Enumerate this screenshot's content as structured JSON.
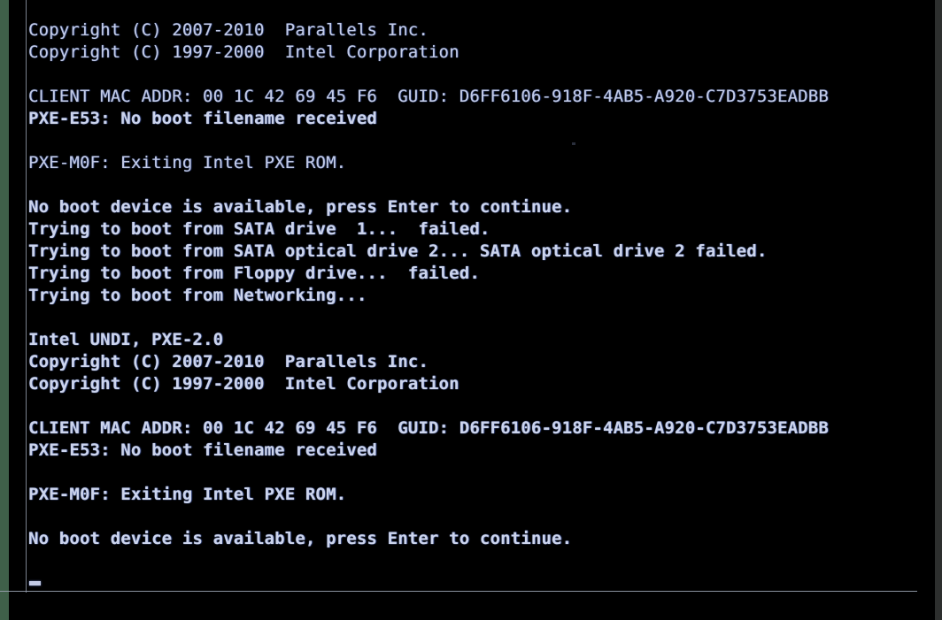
{
  "screen": {
    "title": "Parallels PXE boot console",
    "background_color": "#000000",
    "text_color": "#c3cbe6",
    "edge_strip_left_color": "#3f6049",
    "edge_strip_right_color": "#2d2f2e",
    "frame_line_color": "#99a2b0",
    "cursor": "_"
  },
  "console": {
    "lines": [
      {
        "text": "Copyright (C) 2007-2010  Parallels Inc.",
        "bold": false
      },
      {
        "text": "Copyright (C) 1997-2000  Intel Corporation",
        "bold": false
      },
      {
        "text": "",
        "bold": false
      },
      {
        "text": "CLIENT MAC ADDR: 00 1C 42 69 45 F6  GUID: D6FF6106-918F-4AB5-A920-C7D3753EADBB",
        "bold": false
      },
      {
        "text": "PXE-E53: No boot filename received",
        "bold": true
      },
      {
        "text": "",
        "bold": false
      },
      {
        "text": "PXE-M0F: Exiting Intel PXE ROM.",
        "bold": false
      },
      {
        "text": "",
        "bold": false
      },
      {
        "text": "No boot device is available, press Enter to continue.",
        "bold": true
      },
      {
        "text": "Trying to boot from SATA drive  1...  failed.",
        "bold": true
      },
      {
        "text": "Trying to boot from SATA optical drive 2... SATA optical drive 2 failed.",
        "bold": true
      },
      {
        "text": "Trying to boot from Floppy drive...  failed.",
        "bold": true
      },
      {
        "text": "Trying to boot from Networking...",
        "bold": true
      },
      {
        "text": "",
        "bold": false
      },
      {
        "text": "Intel UNDI, PXE-2.0",
        "bold": true
      },
      {
        "text": "Copyright (C) 2007-2010  Parallels Inc.",
        "bold": true
      },
      {
        "text": "Copyright (C) 1997-2000  Intel Corporation",
        "bold": true
      },
      {
        "text": "",
        "bold": false
      },
      {
        "text": "CLIENT MAC ADDR: 00 1C 42 69 45 F6  GUID: D6FF6106-918F-4AB5-A920-C7D3753EADBB",
        "bold": true
      },
      {
        "text": "PXE-E53: No boot filename received",
        "bold": true
      },
      {
        "text": "",
        "bold": false
      },
      {
        "text": "PXE-M0F: Exiting Intel PXE ROM.",
        "bold": true
      },
      {
        "text": "",
        "bold": false
      },
      {
        "text": "No boot device is available, press Enter to continue.",
        "bold": true
      }
    ]
  },
  "details": {
    "mac_address": "00 1C 42 69 45 F6",
    "guid": "D6FF6106-918F-4AB5-A920-C7D3753EADBB",
    "pxe_error_code": "PXE-E53",
    "pxe_exit_code": "PXE-M0F",
    "pxe_version": "PXE-2.0",
    "vendor_parallels": "Parallels Inc.",
    "vendor_intel": "Intel Corporation",
    "copyright_parallels_years": "2007-2010",
    "copyright_intel_years": "1997-2000"
  }
}
